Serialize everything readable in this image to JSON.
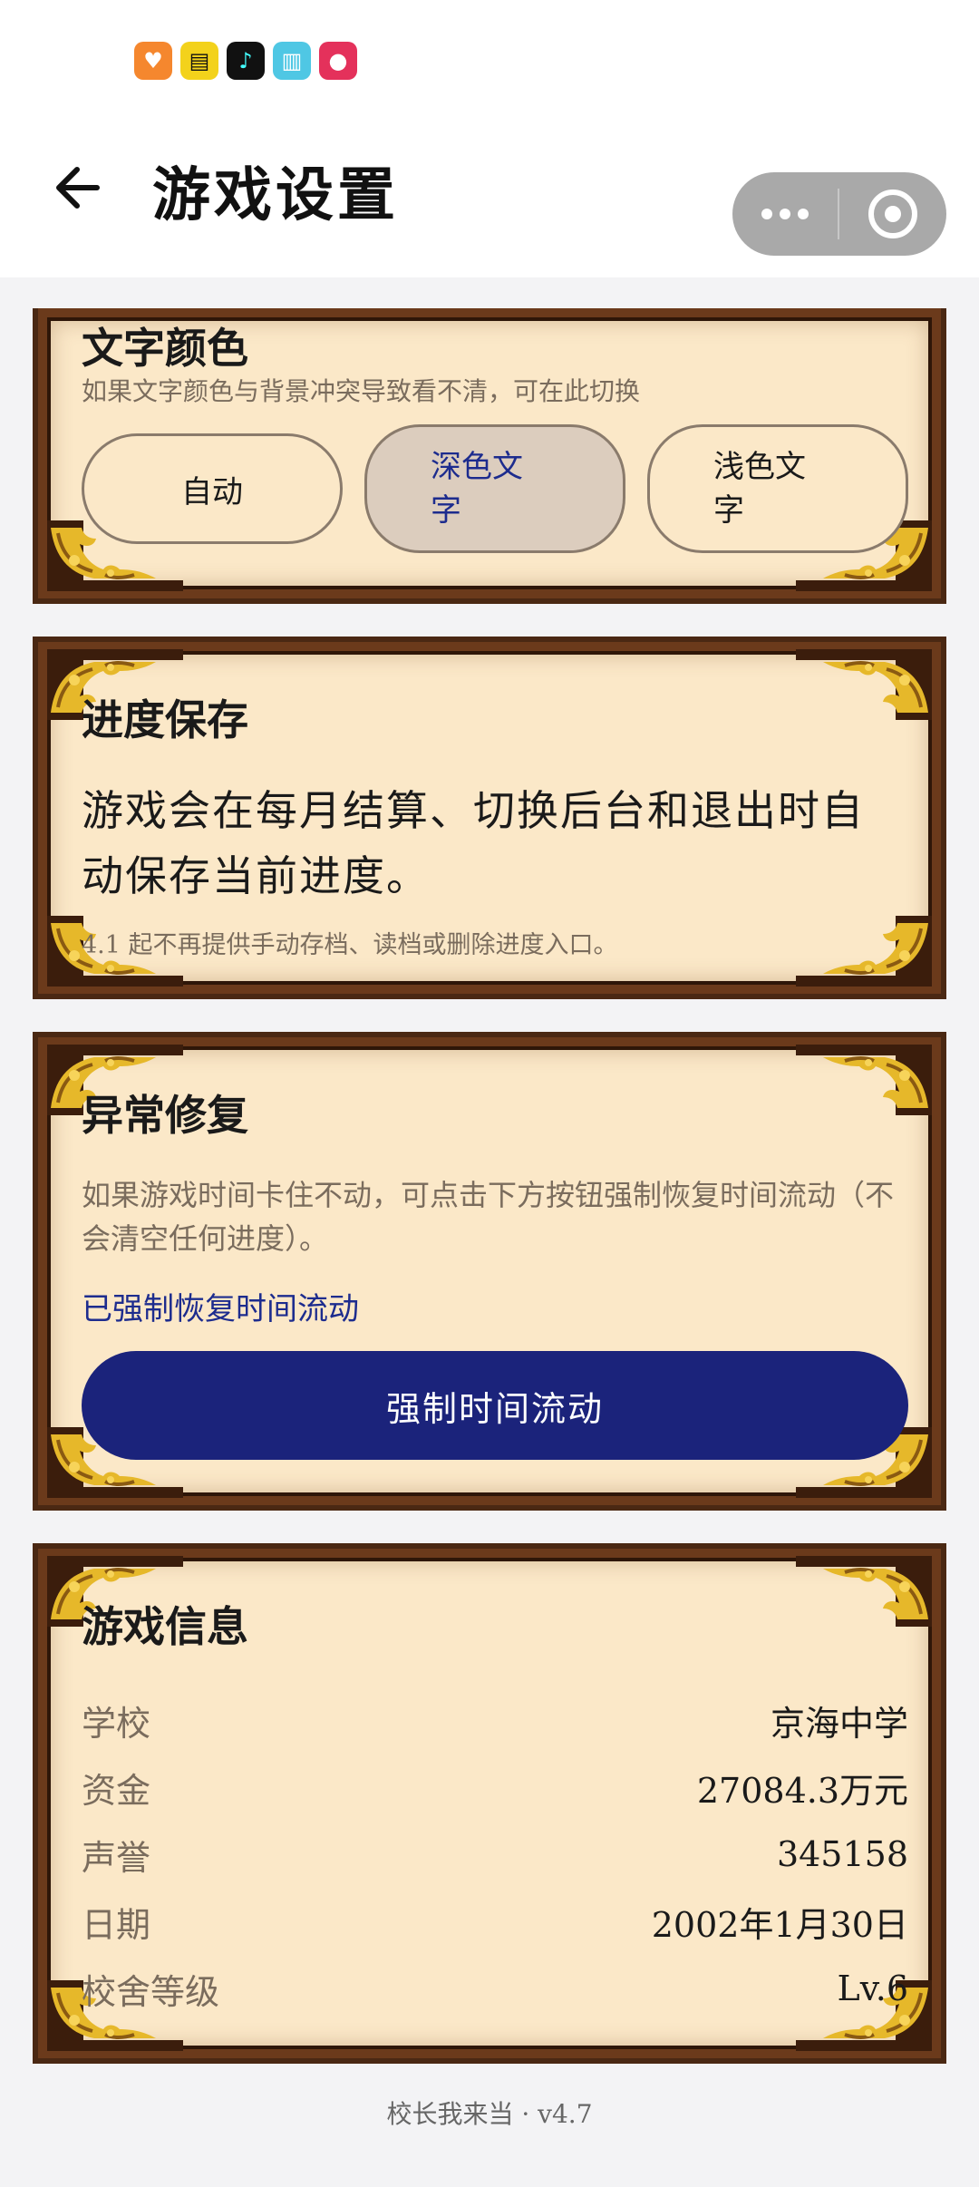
{
  "status_icons": [
    {
      "name": "heart-app-icon",
      "glyph": "♥",
      "color": "#f5872e"
    },
    {
      "name": "clapper-app-icon",
      "glyph": "▤",
      "color": "#f3d21b"
    },
    {
      "name": "music-note-app-icon",
      "glyph": "♪",
      "color": "#111111"
    },
    {
      "name": "book-app-icon",
      "glyph": "▥",
      "color": "#4fc7e4"
    },
    {
      "name": "face-app-icon",
      "glyph": "●",
      "color": "#e4315b"
    }
  ],
  "nav": {
    "title": "游戏设置",
    "back_icon": "arrow-left-icon",
    "more_icon": "more-dots-icon",
    "close_icon": "target-close-icon"
  },
  "text_color": {
    "title": "文字颜色",
    "desc": "如果文字颜色与背景冲突导致看不清，可在此切换",
    "options": [
      {
        "label": "自动",
        "selected": false
      },
      {
        "label_line1": "深色文",
        "label_line2": "字",
        "selected": true
      },
      {
        "label_line1": "浅色文",
        "label_line2": "字",
        "selected": false
      }
    ]
  },
  "save": {
    "title": "进度保存",
    "body": "游戏会在每月结算、切换后台和退出时自动保存当前进度。",
    "note": "4.1 起不再提供手动存档、读档或删除进度入口。"
  },
  "repair": {
    "title": "异常修复",
    "desc": "如果游戏时间卡住不动，可点击下方按钮强制恢复时间流动（不会清空任何进度）。",
    "status": "已强制恢复时间流动",
    "button_label": "强制时间流动"
  },
  "info": {
    "title": "游戏信息",
    "rows": [
      {
        "key": "学校",
        "value": "京海中学"
      },
      {
        "key": "资金",
        "value": "27084.3万元"
      },
      {
        "key": "声誉",
        "value": "345158"
      },
      {
        "key": "日期",
        "value": "2002年1月30日"
      },
      {
        "key": "校舍等级",
        "value": "Lv.6"
      }
    ]
  },
  "footer": "校长我来当 · v4.7",
  "colors": {
    "panel_bg": "#fbe8c8",
    "frame_dark": "#4a2813",
    "gold": "#e6b82a",
    "accent_blue": "#1b237b",
    "muted_text": "#7a6c5d"
  }
}
